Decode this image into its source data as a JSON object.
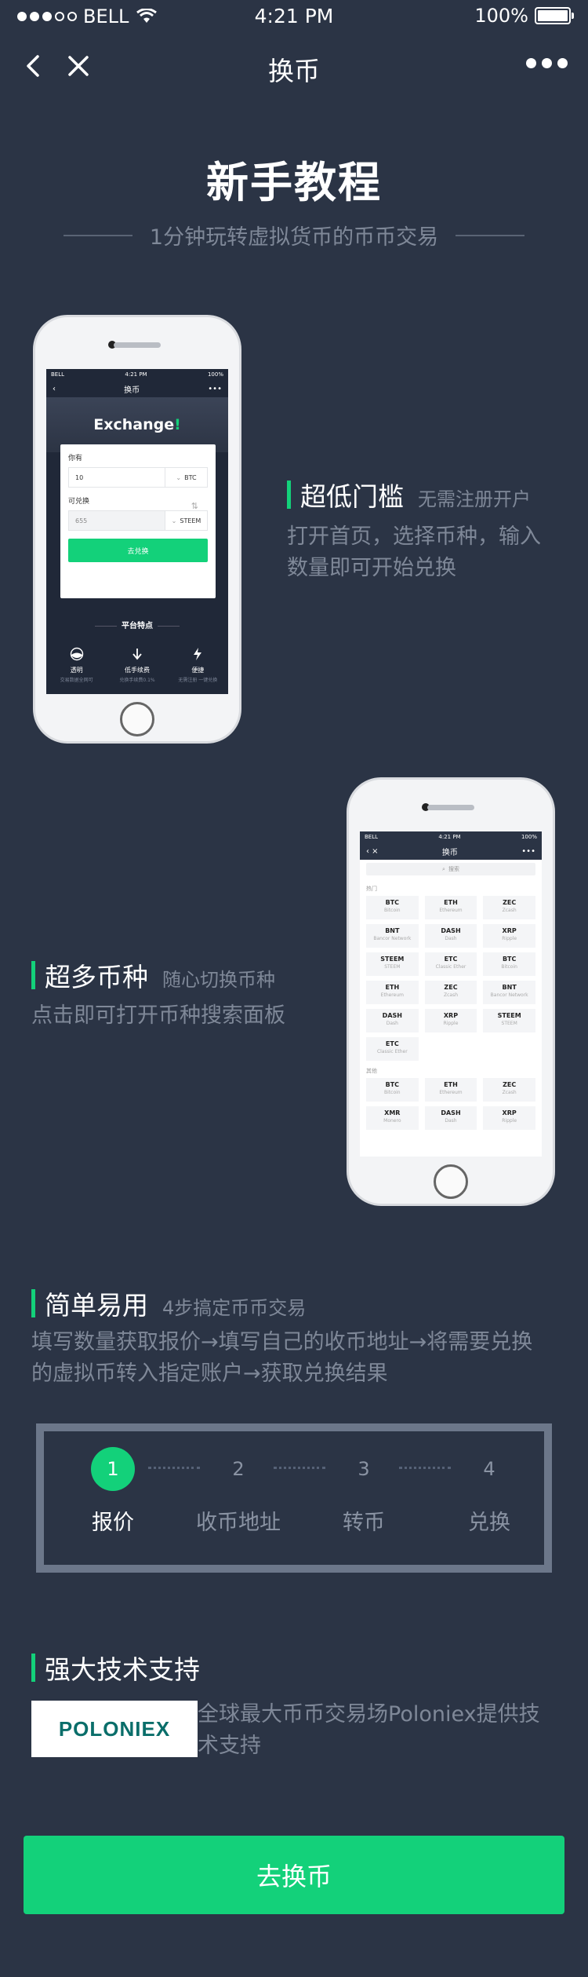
{
  "status_bar": {
    "carrier": "BELL",
    "time": "4:21 PM",
    "battery": "100%"
  },
  "nav": {
    "title": "换币"
  },
  "hero": {
    "title": "新手教程",
    "subtitle": "1分钟玩转虚拟货币的币币交易"
  },
  "phone1": {
    "status": {
      "carrier": "BELL",
      "time": "4:21 PM",
      "battery": "100%"
    },
    "nav_title": "换币",
    "banner": "Exchange",
    "banner_mark": "!",
    "have_label": "你有",
    "have_value": "10",
    "have_currency": "BTC",
    "get_label": "可兑换",
    "get_value": "655",
    "get_currency": "STEEM",
    "button": "去兑换",
    "features_title": "平台特点",
    "features": [
      {
        "label": "透明",
        "sub": "交易数据全网可"
      },
      {
        "label": "低手续费",
        "sub": "兑换手续费0.1%"
      },
      {
        "label": "便捷",
        "sub": "无需注册 一键兑换"
      }
    ]
  },
  "section1": {
    "title": "超低门槛",
    "aux": "无需注册开户",
    "desc_line1": "打开首页，选择币种，输入",
    "desc_line2": "数量即可开始兑换"
  },
  "phone2": {
    "status": {
      "carrier": "BELL",
      "time": "4:21 PM",
      "battery": "100%"
    },
    "nav_title": "换币",
    "search_placeholder": "搜索",
    "hot_label": "热门",
    "hot": [
      {
        "code": "BTC",
        "name": "Bitcoin"
      },
      {
        "code": "ETH",
        "name": "Ethereum"
      },
      {
        "code": "ZEC",
        "name": "Zcash"
      },
      {
        "code": "BNT",
        "name": "Bancor Network"
      },
      {
        "code": "DASH",
        "name": "Dash"
      },
      {
        "code": "XRP",
        "name": "Ripple"
      },
      {
        "code": "STEEM",
        "name": "STEEM"
      },
      {
        "code": "ETC",
        "name": "Classic Ether"
      },
      {
        "code": "BTC",
        "name": "Bitcoin"
      },
      {
        "code": "ETH",
        "name": "Ethereum"
      },
      {
        "code": "ZEC",
        "name": "Zcash"
      },
      {
        "code": "BNT",
        "name": "Bancor Network"
      },
      {
        "code": "DASH",
        "name": "Dash"
      },
      {
        "code": "XRP",
        "name": "Ripple"
      },
      {
        "code": "STEEM",
        "name": "STEEM"
      },
      {
        "code": "ETC",
        "name": "Classic Ether"
      }
    ],
    "other_label": "其他",
    "other": [
      {
        "code": "BTC",
        "name": "Bitcoin"
      },
      {
        "code": "ETH",
        "name": "Ethereum"
      },
      {
        "code": "ZEC",
        "name": "Zcash"
      },
      {
        "code": "XMR",
        "name": "Monero"
      },
      {
        "code": "DASH",
        "name": "Dash"
      },
      {
        "code": "XRP",
        "name": "Ripple"
      }
    ]
  },
  "section2": {
    "title": "超多币种",
    "aux": "随心切换币种",
    "desc": "点击即可打开币种搜索面板"
  },
  "section3": {
    "title": "简单易用",
    "aux": "4步搞定币币交易",
    "desc_line1": "填写数量获取报价→填写自己的收币地址→将需要兑换",
    "desc_line2": "的虚拟币转入指定账户→获取兑换结果"
  },
  "steps": [
    {
      "num": "1",
      "label": "报价"
    },
    {
      "num": "2",
      "label": "收币地址"
    },
    {
      "num": "3",
      "label": "转币"
    },
    {
      "num": "4",
      "label": "兑换"
    }
  ],
  "section4": {
    "title": "强大技术支持",
    "logo": "POLONIEX",
    "desc_line1": "全球最大币币交易场Poloniex提供技",
    "desc_line2": "术支持"
  },
  "cta": {
    "label": "去换币"
  },
  "colors": {
    "background": "#2b3445",
    "accent": "#13d17a",
    "muted_text": "#7f8898"
  }
}
